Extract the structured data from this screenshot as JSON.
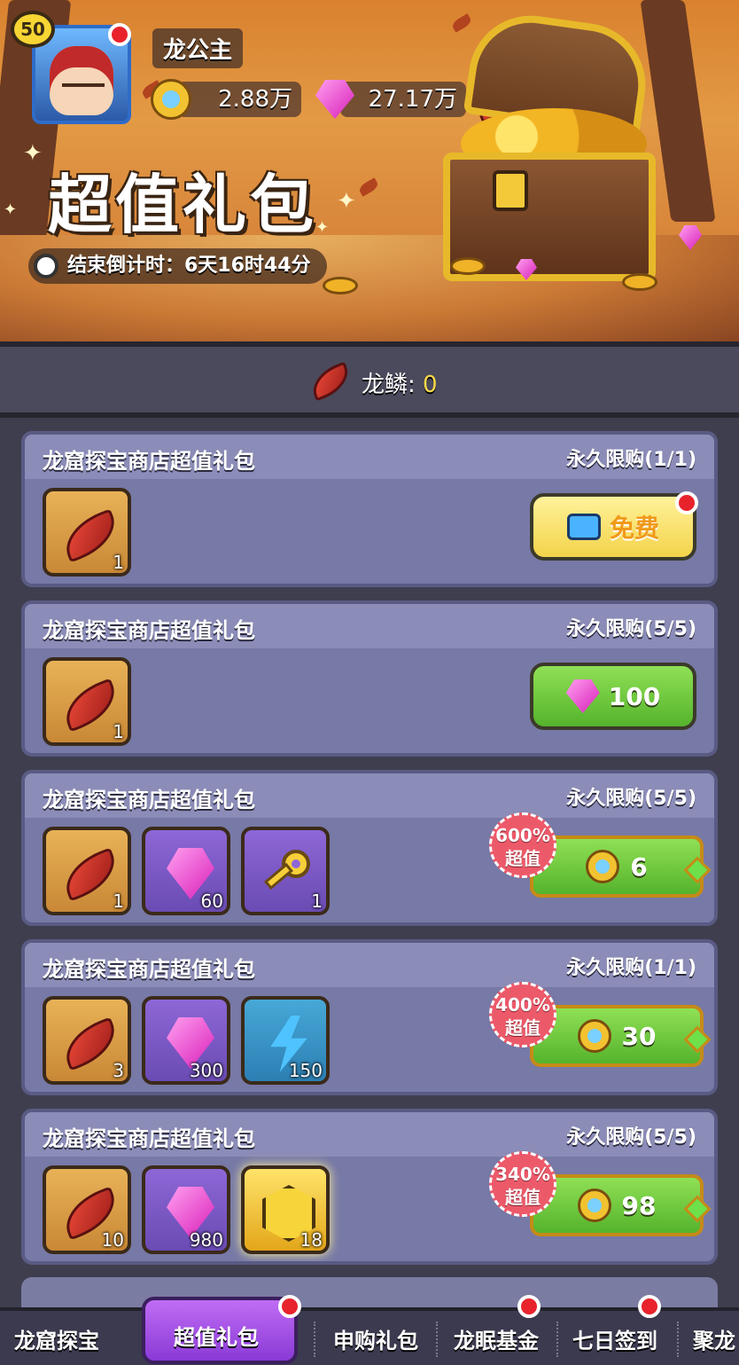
{
  "player": {
    "level": "50",
    "name": "龙公主",
    "coins": "2.88万",
    "gems": "27.17万",
    "scales": "0"
  },
  "banner": {
    "title": "超值礼包",
    "countdown": "结束倒计时：6天16时44分"
  },
  "currency_bar": {
    "label": "龙鳞:",
    "value": "0"
  },
  "packs": [
    {
      "title": "龙窟探宝商店超值礼包",
      "limit": "永久限购(1/1)",
      "items": [
        {
          "icon": "dragon-scale-icon",
          "count": "1"
        }
      ],
      "button": {
        "type": "ad",
        "label": "免费"
      }
    },
    {
      "title": "龙窟探宝商店超值礼包",
      "limit": "永久限购(5/5)",
      "items": [
        {
          "icon": "dragon-scale-icon",
          "count": "1"
        }
      ],
      "button": {
        "type": "gem",
        "label": "100"
      }
    },
    {
      "title": "龙窟探宝商店超值礼包",
      "limit": "永久限购(5/5)",
      "items": [
        {
          "icon": "dragon-scale-icon",
          "count": "1"
        },
        {
          "icon": "gem-icon",
          "count": "60"
        },
        {
          "icon": "key-icon",
          "count": "1"
        }
      ],
      "badge": {
        "percent": "600%",
        "text": "超值"
      },
      "button": {
        "type": "coin",
        "label": "6"
      }
    },
    {
      "title": "龙窟探宝商店超值礼包",
      "limit": "永久限购(1/1)",
      "items": [
        {
          "icon": "dragon-scale-icon",
          "count": "3"
        },
        {
          "icon": "gem-icon",
          "count": "300"
        },
        {
          "icon": "lightning-icon",
          "count": "150"
        }
      ],
      "badge": {
        "percent": "400%",
        "text": "超值"
      },
      "button": {
        "type": "coin",
        "label": "30"
      }
    },
    {
      "title": "龙窟探宝商店超值礼包",
      "limit": "永久限购(5/5)",
      "items": [
        {
          "icon": "dragon-scale-icon",
          "count": "10"
        },
        {
          "icon": "gem-icon",
          "count": "980"
        },
        {
          "icon": "gold-hexagon-icon",
          "count": "18"
        }
      ],
      "badge": {
        "percent": "340%",
        "text": "超值"
      },
      "button": {
        "type": "coin",
        "label": "98"
      }
    }
  ],
  "tabs": [
    "龙窟探宝",
    "超值礼包",
    "申购礼包",
    "龙眠基金",
    "七日签到",
    "聚龙"
  ],
  "active_tab": "超值礼包",
  "colors": {
    "header_orange": "#d9812e",
    "card_bg": "#7779a6",
    "button_green": "#55b32c",
    "button_yellow": "#f3d34a",
    "active_tab_purple": "#8a3ad6",
    "notification_red": "#e8232c",
    "scale_value_yellow": "#f9d84a"
  }
}
